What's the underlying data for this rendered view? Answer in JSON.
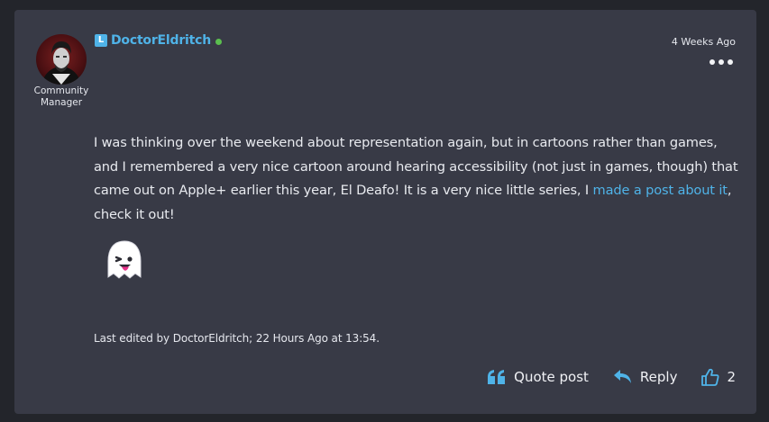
{
  "post": {
    "username": "DoctorEldritch",
    "user_badge": "L",
    "role": "Community Manager",
    "timestamp": "4 Weeks Ago",
    "body_part1": "I was thinking over the weekend about representation again, but in cartoons rather than games, and I remembered a very nice cartoon around hearing accessibility (not just in games, though) that came out on Apple+ earlier this year, El Deafo! It is a very nice little series, I ",
    "body_link": "made a post about it",
    "body_part2": ", check it out!",
    "emoji": "ghost-winking-tongue",
    "edited_note": "Last edited by DoctorEldritch; 22 Hours Ago at 13:54."
  },
  "actions": {
    "quote_label": "Quote post",
    "reply_label": "Reply",
    "like_count": "2"
  },
  "colors": {
    "background": "#23252b",
    "card": "#383a46",
    "accent": "#4fb3e8",
    "online": "#5bbf4f",
    "text": "#e8eaef"
  }
}
